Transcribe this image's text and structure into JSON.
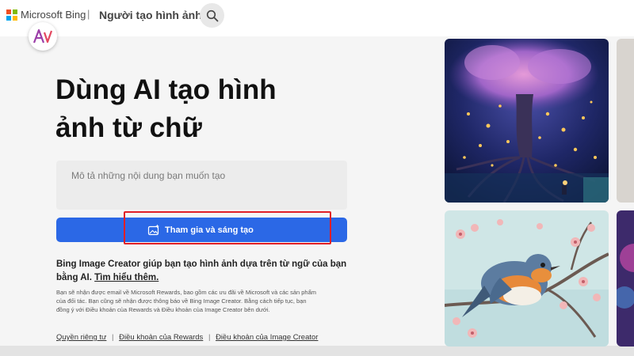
{
  "header": {
    "brand": "Microsoft Bing",
    "separator": "|",
    "page_title": "Người tạo hình ảnh",
    "search_icon": "search-icon",
    "logo_colors": [
      "#f25022",
      "#7fba00",
      "#00a4ef",
      "#ffb900"
    ]
  },
  "avatar": {
    "icon": "rewards-avatar-icon"
  },
  "hero": {
    "line1": "Dùng AI tạo hình",
    "line2": "ảnh từ chữ"
  },
  "prompt": {
    "placeholder": "Mô tả những nội dung bạn muốn tạo",
    "value": ""
  },
  "join_button": {
    "label": "Tham gia và sáng tạo",
    "icon": "image-sparkle-icon",
    "color": "#2b68e6",
    "highlight_color": "#e01f26"
  },
  "description": {
    "text": "Bing Image Creator giúp bạn tạo hình ảnh dựa trên từ ngữ của bạn bằng AI.",
    "learn_more": "Tìm hiểu thêm."
  },
  "fine_print": "Bạn sẽ nhận được email về Microsoft Rewards, bao gồm các ưu đãi về Microsoft và các sản phẩm của đối tác. Bạn cũng sẽ nhận được thông báo về Bing Image Creator. Bằng cách tiếp tục, bạn đồng ý với Điều khoản của Rewards và Điều khoản của Image Creator bên dưới.",
  "footer_links": {
    "privacy": "Quyền riêng tư",
    "rewards_terms": "Điều khoản của Rewards",
    "creator_terms": "Điều khoản của Image Creator",
    "separator": "|"
  }
}
